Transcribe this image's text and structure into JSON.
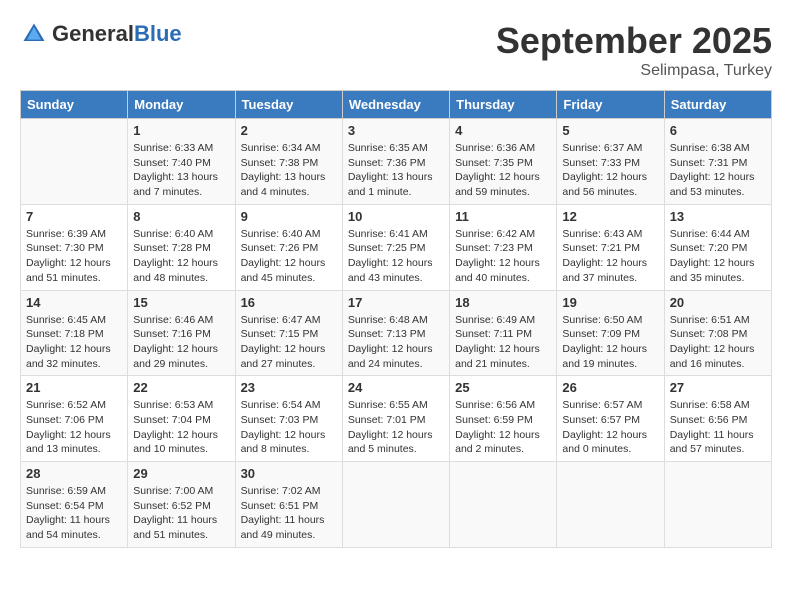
{
  "header": {
    "logo_general": "General",
    "logo_blue": "Blue",
    "month": "September 2025",
    "location": "Selimpasa, Turkey"
  },
  "days_of_week": [
    "Sunday",
    "Monday",
    "Tuesday",
    "Wednesday",
    "Thursday",
    "Friday",
    "Saturday"
  ],
  "weeks": [
    [
      {
        "day": "",
        "info": ""
      },
      {
        "day": "1",
        "info": "Sunrise: 6:33 AM\nSunset: 7:40 PM\nDaylight: 13 hours\nand 7 minutes."
      },
      {
        "day": "2",
        "info": "Sunrise: 6:34 AM\nSunset: 7:38 PM\nDaylight: 13 hours\nand 4 minutes."
      },
      {
        "day": "3",
        "info": "Sunrise: 6:35 AM\nSunset: 7:36 PM\nDaylight: 13 hours\nand 1 minute."
      },
      {
        "day": "4",
        "info": "Sunrise: 6:36 AM\nSunset: 7:35 PM\nDaylight: 12 hours\nand 59 minutes."
      },
      {
        "day": "5",
        "info": "Sunrise: 6:37 AM\nSunset: 7:33 PM\nDaylight: 12 hours\nand 56 minutes."
      },
      {
        "day": "6",
        "info": "Sunrise: 6:38 AM\nSunset: 7:31 PM\nDaylight: 12 hours\nand 53 minutes."
      }
    ],
    [
      {
        "day": "7",
        "info": "Sunrise: 6:39 AM\nSunset: 7:30 PM\nDaylight: 12 hours\nand 51 minutes."
      },
      {
        "day": "8",
        "info": "Sunrise: 6:40 AM\nSunset: 7:28 PM\nDaylight: 12 hours\nand 48 minutes."
      },
      {
        "day": "9",
        "info": "Sunrise: 6:40 AM\nSunset: 7:26 PM\nDaylight: 12 hours\nand 45 minutes."
      },
      {
        "day": "10",
        "info": "Sunrise: 6:41 AM\nSunset: 7:25 PM\nDaylight: 12 hours\nand 43 minutes."
      },
      {
        "day": "11",
        "info": "Sunrise: 6:42 AM\nSunset: 7:23 PM\nDaylight: 12 hours\nand 40 minutes."
      },
      {
        "day": "12",
        "info": "Sunrise: 6:43 AM\nSunset: 7:21 PM\nDaylight: 12 hours\nand 37 minutes."
      },
      {
        "day": "13",
        "info": "Sunrise: 6:44 AM\nSunset: 7:20 PM\nDaylight: 12 hours\nand 35 minutes."
      }
    ],
    [
      {
        "day": "14",
        "info": "Sunrise: 6:45 AM\nSunset: 7:18 PM\nDaylight: 12 hours\nand 32 minutes."
      },
      {
        "day": "15",
        "info": "Sunrise: 6:46 AM\nSunset: 7:16 PM\nDaylight: 12 hours\nand 29 minutes."
      },
      {
        "day": "16",
        "info": "Sunrise: 6:47 AM\nSunset: 7:15 PM\nDaylight: 12 hours\nand 27 minutes."
      },
      {
        "day": "17",
        "info": "Sunrise: 6:48 AM\nSunset: 7:13 PM\nDaylight: 12 hours\nand 24 minutes."
      },
      {
        "day": "18",
        "info": "Sunrise: 6:49 AM\nSunset: 7:11 PM\nDaylight: 12 hours\nand 21 minutes."
      },
      {
        "day": "19",
        "info": "Sunrise: 6:50 AM\nSunset: 7:09 PM\nDaylight: 12 hours\nand 19 minutes."
      },
      {
        "day": "20",
        "info": "Sunrise: 6:51 AM\nSunset: 7:08 PM\nDaylight: 12 hours\nand 16 minutes."
      }
    ],
    [
      {
        "day": "21",
        "info": "Sunrise: 6:52 AM\nSunset: 7:06 PM\nDaylight: 12 hours\nand 13 minutes."
      },
      {
        "day": "22",
        "info": "Sunrise: 6:53 AM\nSunset: 7:04 PM\nDaylight: 12 hours\nand 10 minutes."
      },
      {
        "day": "23",
        "info": "Sunrise: 6:54 AM\nSunset: 7:03 PM\nDaylight: 12 hours\nand 8 minutes."
      },
      {
        "day": "24",
        "info": "Sunrise: 6:55 AM\nSunset: 7:01 PM\nDaylight: 12 hours\nand 5 minutes."
      },
      {
        "day": "25",
        "info": "Sunrise: 6:56 AM\nSunset: 6:59 PM\nDaylight: 12 hours\nand 2 minutes."
      },
      {
        "day": "26",
        "info": "Sunrise: 6:57 AM\nSunset: 6:57 PM\nDaylight: 12 hours\nand 0 minutes."
      },
      {
        "day": "27",
        "info": "Sunrise: 6:58 AM\nSunset: 6:56 PM\nDaylight: 11 hours\nand 57 minutes."
      }
    ],
    [
      {
        "day": "28",
        "info": "Sunrise: 6:59 AM\nSunset: 6:54 PM\nDaylight: 11 hours\nand 54 minutes."
      },
      {
        "day": "29",
        "info": "Sunrise: 7:00 AM\nSunset: 6:52 PM\nDaylight: 11 hours\nand 51 minutes."
      },
      {
        "day": "30",
        "info": "Sunrise: 7:02 AM\nSunset: 6:51 PM\nDaylight: 11 hours\nand 49 minutes."
      },
      {
        "day": "",
        "info": ""
      },
      {
        "day": "",
        "info": ""
      },
      {
        "day": "",
        "info": ""
      },
      {
        "day": "",
        "info": ""
      }
    ]
  ]
}
